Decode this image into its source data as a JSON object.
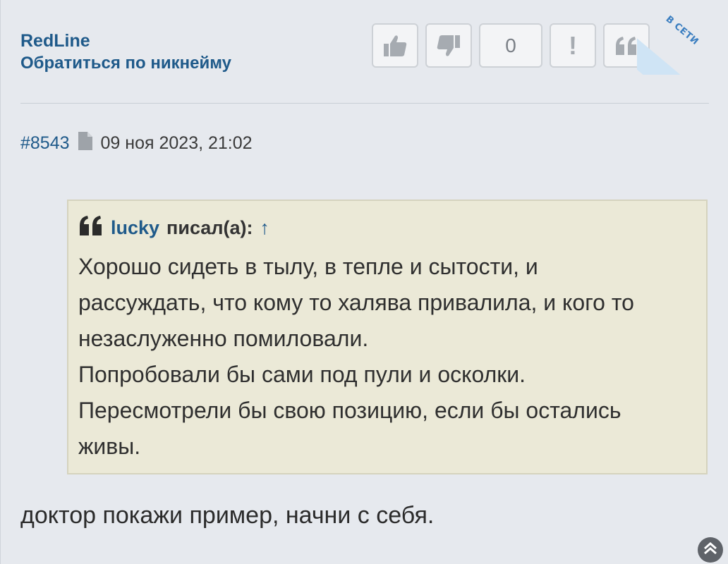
{
  "author": {
    "name": "RedLine",
    "mention_link": "Обратиться по никнейму"
  },
  "actions": {
    "like_icon": "thumbs-up-icon",
    "dislike_icon": "thumbs-down-icon",
    "rating": "0",
    "report_label": "!",
    "quote_icon": "quote-icon"
  },
  "status": {
    "online": "В СЕТИ",
    "online_color": "#cfe4f5"
  },
  "meta": {
    "post_number": "#8543",
    "date": "09 ноя 2023, 21:02"
  },
  "quote": {
    "user": "lucky",
    "wrote": "писал(а):",
    "arrow": "↑",
    "lines": [
      "Хорошо сидеть в тылу, в тепле и сытости, и",
      "рассуждать, что кому то халява привалила, и кого то",
      "незаслуженно помиловали.",
      "Попробовали бы сами под пули и осколки.",
      "Пересмотрели бы свою позицию, если бы остались",
      "живы."
    ]
  },
  "reply_text": "доктор покажи пример, начни с себя.",
  "colors": {
    "link": "#1f5a8a",
    "background": "#e6e9ee",
    "quote_background": "#ebe9d7"
  }
}
